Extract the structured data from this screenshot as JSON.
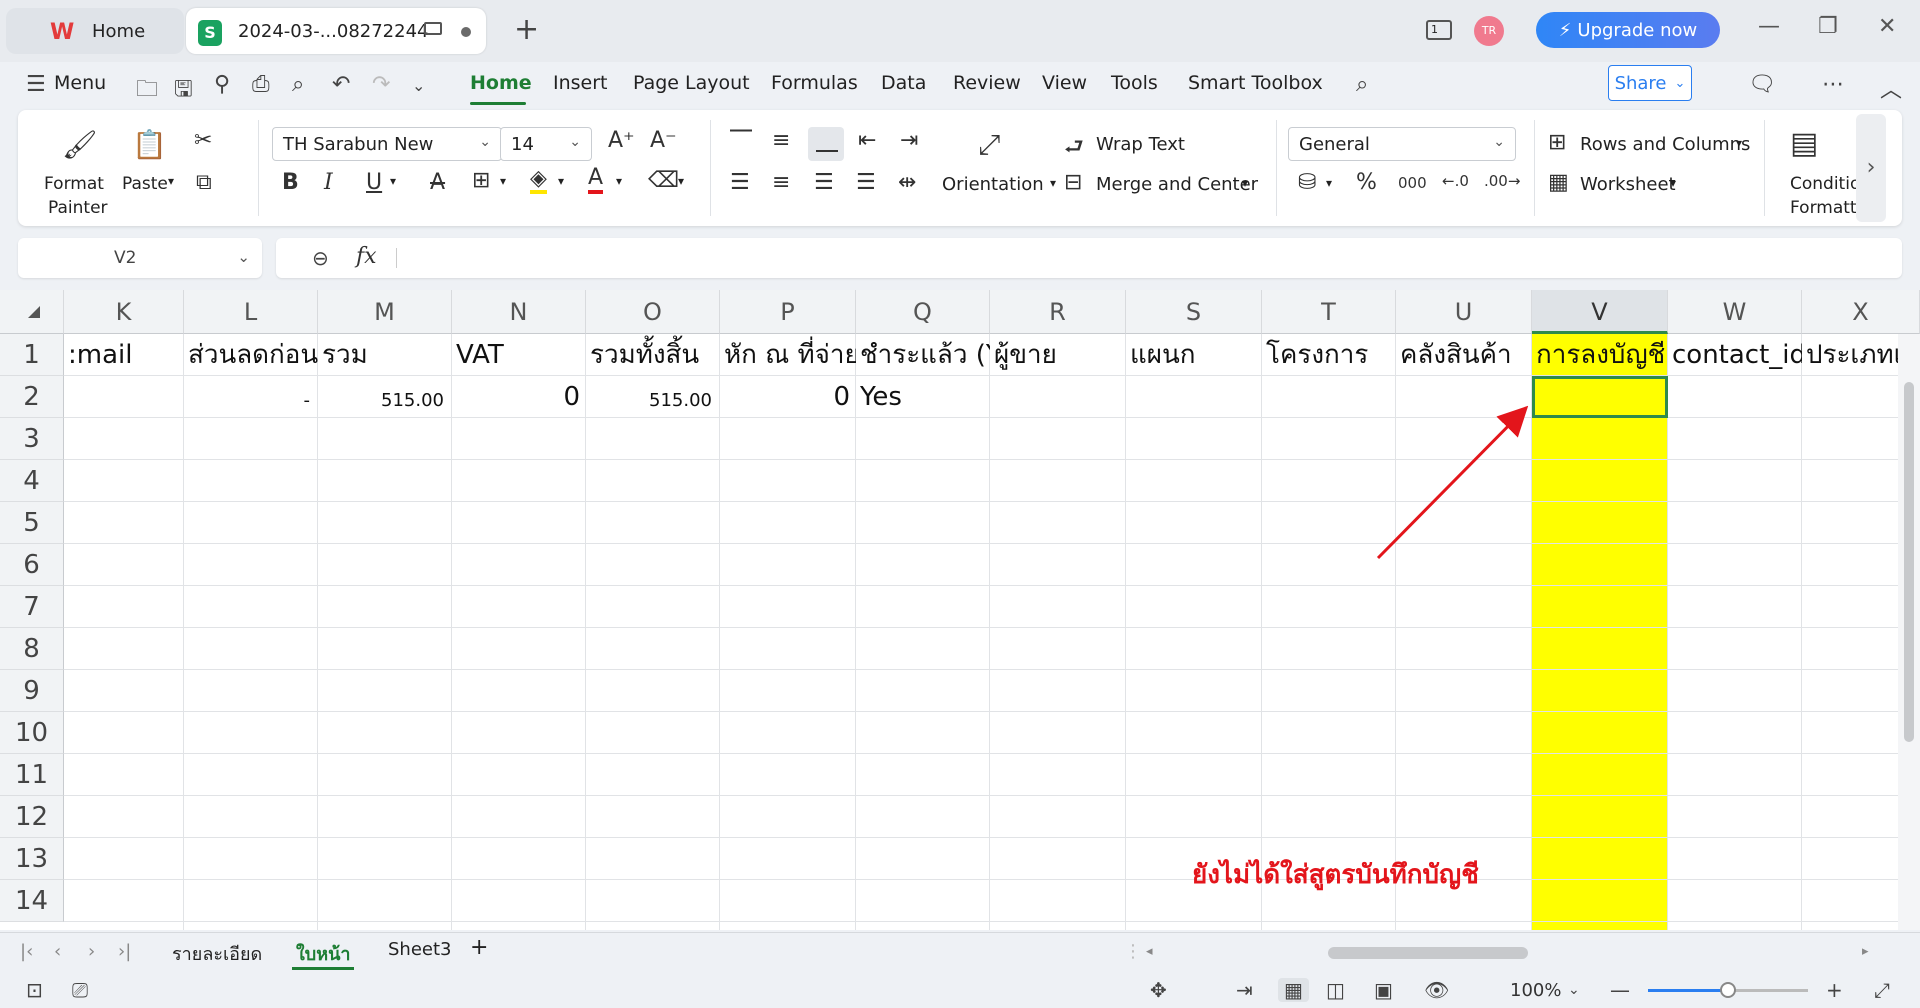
{
  "tabs": {
    "home_label": "Home",
    "doc_label": "2024-03-...08272244",
    "sheet_logo": "S"
  },
  "topbar": {
    "reader_label": "1",
    "avatar_initials": "TR",
    "upgrade_label": "Upgrade now"
  },
  "menu": {
    "menu_label": "Menu",
    "items": [
      "Home",
      "Insert",
      "Page Layout",
      "Formulas",
      "Data",
      "Review",
      "View",
      "Tools",
      "Smart Toolbox"
    ],
    "share_label": "Share"
  },
  "ribbon": {
    "format_painter_l1": "Format",
    "format_painter_l2": "Painter",
    "paste_label": "Paste",
    "font_name": "TH Sarabun New",
    "font_size": "14",
    "orientation_label": "Orientation",
    "wrap_text_label": "Wrap Text",
    "merge_label": "Merge and Center",
    "number_format": "General",
    "rows_columns_label": "Rows and Columns",
    "worksheet_label": "Worksheet",
    "conditional_l1": "Conditio",
    "conditional_l2": "Formatti"
  },
  "formula_bar": {
    "name_box": "V2",
    "fx": "fx",
    "content": ""
  },
  "grid": {
    "columns": [
      "K",
      "L",
      "M",
      "N",
      "O",
      "P",
      "Q",
      "R",
      "S",
      "T",
      "U",
      "V",
      "W",
      "X"
    ],
    "selected_column": "V",
    "rows": [
      "1",
      "2",
      "3",
      "4",
      "5",
      "6",
      "7",
      "8",
      "9",
      "10",
      "11",
      "12",
      "13",
      "14"
    ],
    "header_row": [
      ":mail",
      "ส่วนลดก่อนภ",
      "รวม",
      "VAT",
      "รวมทั้งสิ้น",
      "หัก ณ ที่จ่าย",
      "ชำระแล้ว (Ye",
      "ผู้ขาย",
      "แผนก",
      "โครงการ",
      "คลังสินค้า",
      "การลงบัญชี",
      "contact_id",
      "ประเภทเ"
    ],
    "row2": {
      "L": "-",
      "M": "515.00",
      "N": "0",
      "O": "515.00",
      "P": "0",
      "Q": "Yes"
    },
    "highlight_color": "#ffff00",
    "active_cell": "V2"
  },
  "annotation": {
    "text": "ยังไม่ได้ใส่สูตรบันทึกบัญชี",
    "color": "#e3151b"
  },
  "sheets": {
    "tabs": [
      "รายละเอียด",
      "ใบหน้า",
      "Sheet3"
    ],
    "active": "ใบหน้า"
  },
  "status": {
    "zoom_label": "100%",
    "zoom_fraction": 0.5
  }
}
